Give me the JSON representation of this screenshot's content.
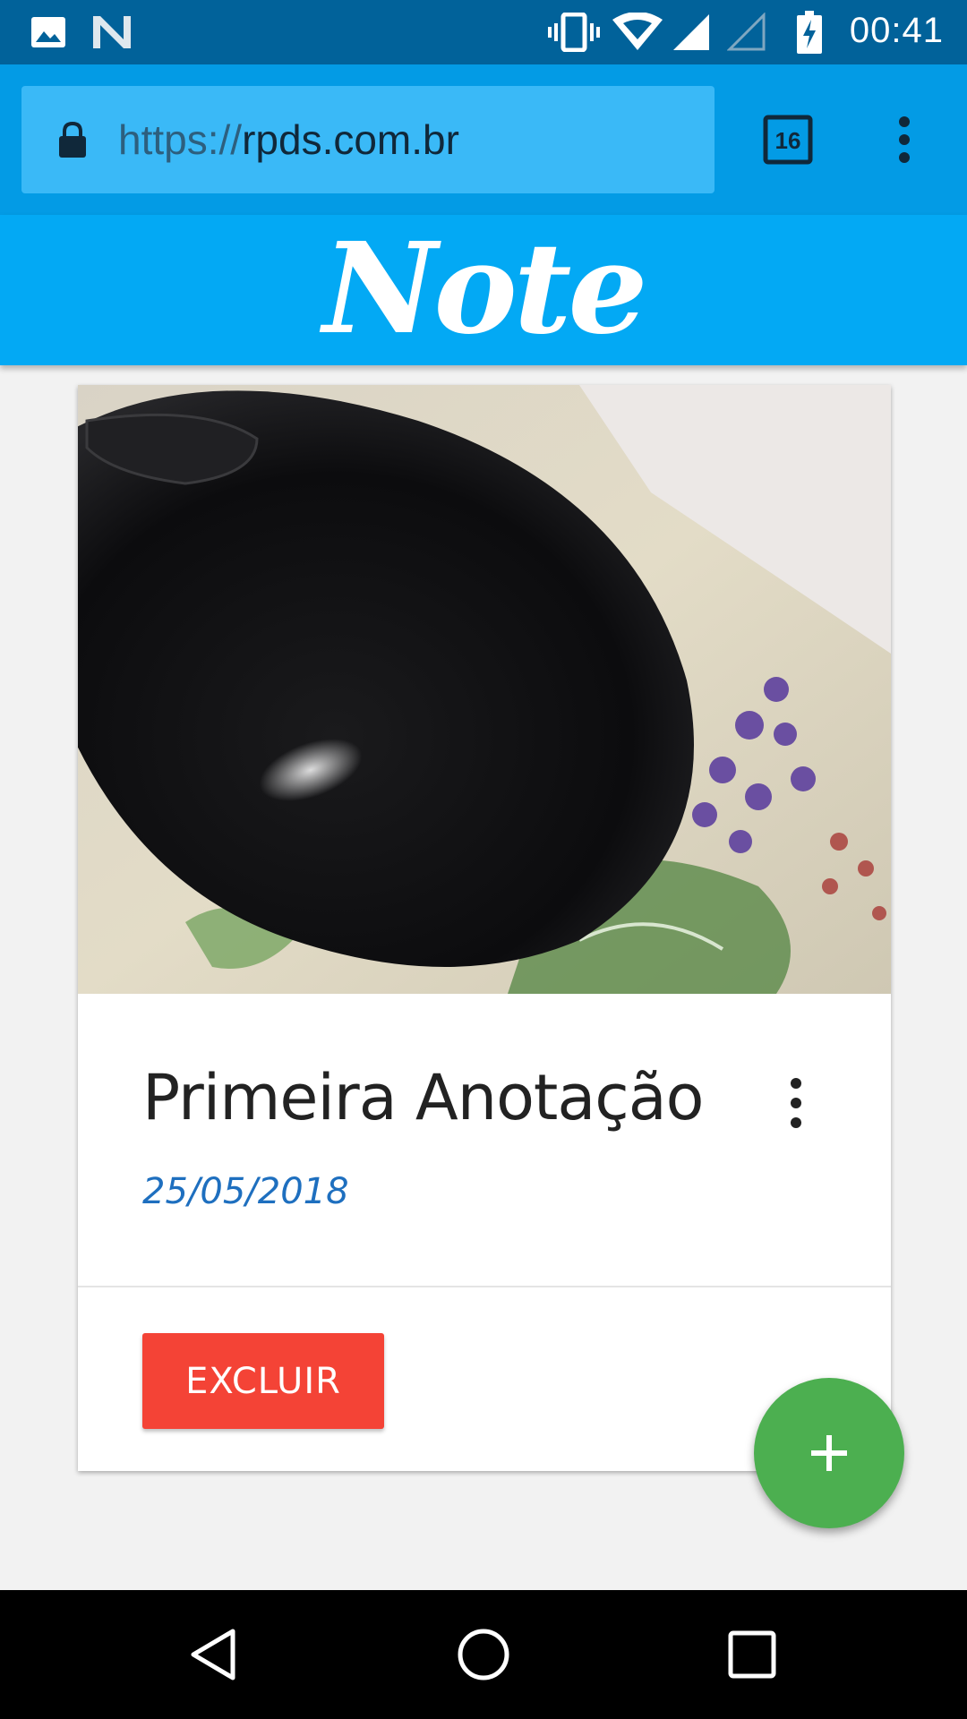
{
  "status_bar": {
    "time": "00:41",
    "icons": [
      "image-icon",
      "n-icon",
      "vibrate-icon",
      "wifi-icon",
      "signal-icon",
      "signal-empty-icon",
      "battery-charging-icon"
    ]
  },
  "browser": {
    "url_scheme": "https://",
    "url_host": "rpds.com.br",
    "tab_count": "16"
  },
  "app": {
    "logo": "Note",
    "colors": {
      "appbar": "#03a9f4",
      "delete": "#f44336",
      "fab": "#4caf50",
      "date": "#1e6fbf"
    }
  },
  "note": {
    "title": "Primeira Anotação",
    "date": "25/05/2018",
    "delete_label": "EXCLUIR"
  },
  "fab": {
    "label": "+"
  },
  "nav": {
    "icons": [
      "back-icon",
      "home-icon",
      "recents-icon"
    ]
  }
}
